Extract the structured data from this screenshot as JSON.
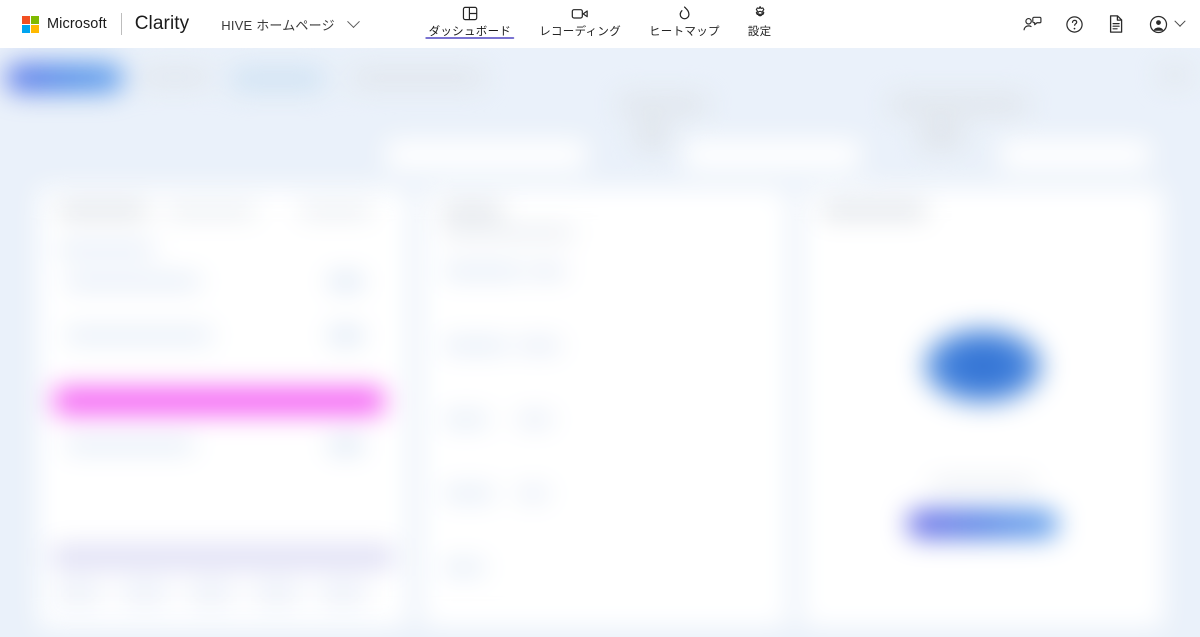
{
  "app": {
    "vendor": "Microsoft",
    "product": "Clarity",
    "logo_colors": [
      "#f25022",
      "#7fba00",
      "#00a4ef",
      "#ffb900"
    ],
    "accent_purple": "#7a73d1",
    "accent_blue": "#4e8de8",
    "highlight_magenta": "#f45cf4",
    "body_background": "#eaf1fa"
  },
  "site_picker": {
    "label": "HIVE ホームページ",
    "chevron_icon": "chevron-down-icon"
  },
  "tabs": [
    {
      "label": "ダッシュボード",
      "icon": "dashboard-icon",
      "active": true
    },
    {
      "label": "レコーディング",
      "icon": "video-camera-icon",
      "active": false
    },
    {
      "label": "ヒートマップ",
      "icon": "flame-icon",
      "active": false
    },
    {
      "label": "設定",
      "icon": "gear-icon",
      "active": false
    }
  ],
  "actions": [
    {
      "name": "feedback-icon",
      "title": "フィードバック"
    },
    {
      "name": "help-icon",
      "title": "ヘルプ"
    },
    {
      "name": "document-icon",
      "title": "ドキュメント"
    }
  ],
  "account": {
    "avatar_icon": "account-circle-icon",
    "chevron_icon": "chevron-down-icon"
  },
  "dashboard": {
    "blurred": true,
    "note": "ダッシュボード本文はぼかし処理されています",
    "toolbar": {
      "primary_button": "",
      "items": [
        "",
        "",
        "",
        "",
        ""
      ]
    },
    "cards": [
      {
        "name": "card-left",
        "title": "",
        "highlighted_row": ""
      },
      {
        "name": "card-middle",
        "title": "",
        "rows": [
          "",
          "",
          "",
          ""
        ]
      },
      {
        "name": "card-right",
        "title": "",
        "empty_state_message": "",
        "empty_state_cta": ""
      }
    ]
  }
}
